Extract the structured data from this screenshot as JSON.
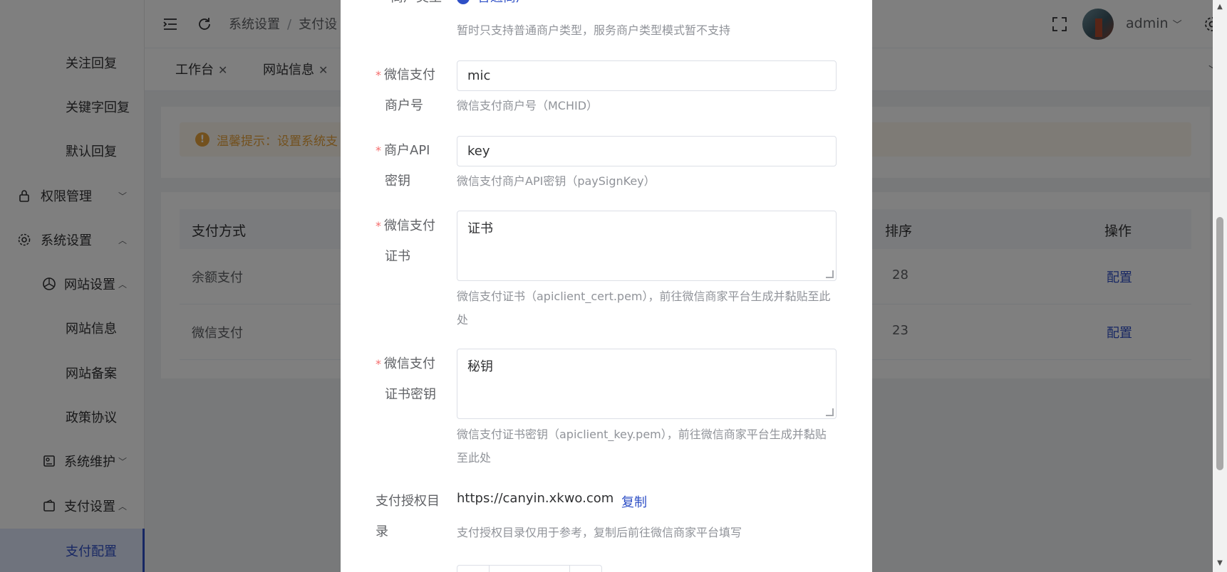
{
  "sidebar": {
    "items": [
      {
        "label": "关注回复"
      },
      {
        "label": "关键字回复"
      },
      {
        "label": "默认回复"
      },
      {
        "label": "权限管理"
      },
      {
        "label": "系统设置"
      },
      {
        "label": "网站设置"
      },
      {
        "label": "网站信息"
      },
      {
        "label": "网站备案"
      },
      {
        "label": "政策协议"
      },
      {
        "label": "系统维护"
      },
      {
        "label": "支付设置"
      },
      {
        "label": "支付配置"
      }
    ]
  },
  "header": {
    "breadcrumb": [
      "系统设置",
      "支付设"
    ],
    "user": "admin"
  },
  "tabs": [
    {
      "label": "工作台"
    },
    {
      "label": "网站信息"
    }
  ],
  "tip": {
    "text": "温馨提示：设置系统支"
  },
  "table": {
    "headers": [
      "支付方式",
      "排序",
      "操作"
    ],
    "rows": [
      {
        "name": "余额支付",
        "sort": "28",
        "action": "配置"
      },
      {
        "name": "微信支付",
        "sort": "23",
        "action": "配置"
      }
    ]
  },
  "modal": {
    "merchant_type": {
      "label": "商户类型",
      "value": "普通商户",
      "help": "暂时只支持普通商户类型，服务商户类型模式暂不支持"
    },
    "mchid": {
      "label_line1": "微信支付",
      "label_line2": "商户号",
      "value": "mic",
      "help": "微信支付商户号（MCHID）"
    },
    "apikey": {
      "label_line1": "商户API",
      "label_line2": "密钥",
      "value": "key",
      "help": "微信支付商户API密钥（paySignKey）"
    },
    "cert": {
      "label_line1": "微信支付",
      "label_line2": "证书",
      "value": "证书",
      "help_line1": "微信支付证书（apiclient_cert.pem），前往微信商家平台生成并黏贴至此",
      "help_line2": "处"
    },
    "cert_key": {
      "label_line1": "微信支付",
      "label_line2": "证书密钥",
      "value": "秘钥",
      "help_line1": "微信支付证书密钥（apiclient_key.pem），前往微信商家平台生成并黏贴",
      "help_line2": "至此处"
    },
    "auth_dir": {
      "label_line1": "支付授权目",
      "label_line2": "录",
      "url": "https://canyin.xkwo.com",
      "copy": "复制",
      "help": "支付授权目录仅用于参考，复制后前往微信商家平台填写"
    }
  },
  "colors": {
    "primary": "#2e4fc6",
    "warning": "#e6a23c",
    "required": "#f56c6c"
  }
}
